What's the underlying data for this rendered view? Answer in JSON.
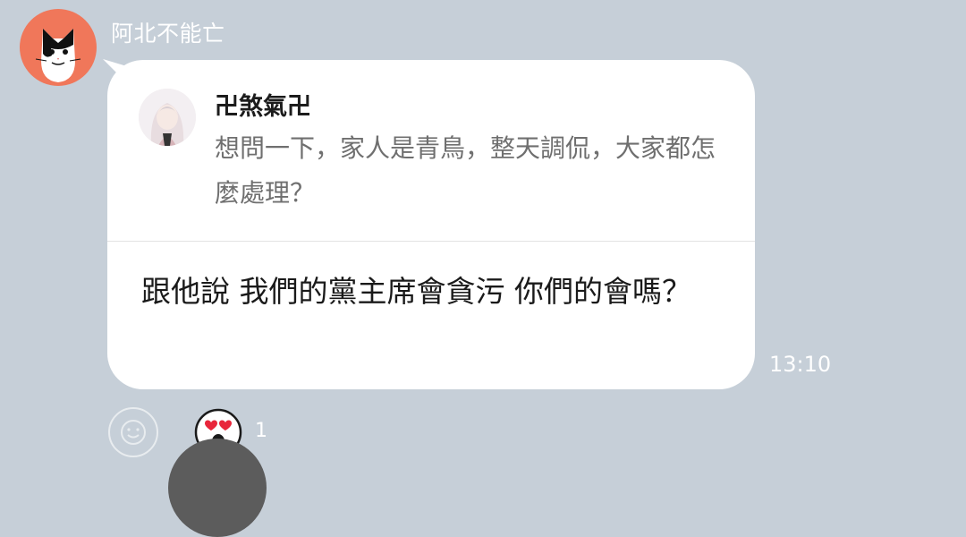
{
  "message": {
    "sender": "阿北不能亡",
    "time": "13:10",
    "quoted": {
      "author": "卍煞氣卍",
      "text": "想問一下，家人是青鳥，整天調侃，大家都怎麼處理？"
    },
    "reply": "跟他說 我們的黨主席會貪污 你們的會嗎？"
  },
  "reactions": {
    "add_icon": "smiley-icon",
    "items": [
      {
        "icon": "heart-eyes-icon",
        "count": "1"
      }
    ]
  },
  "colors": {
    "background": "#c6cfd8",
    "avatar_bg": "#f0775a",
    "bubble": "#ffffff"
  }
}
